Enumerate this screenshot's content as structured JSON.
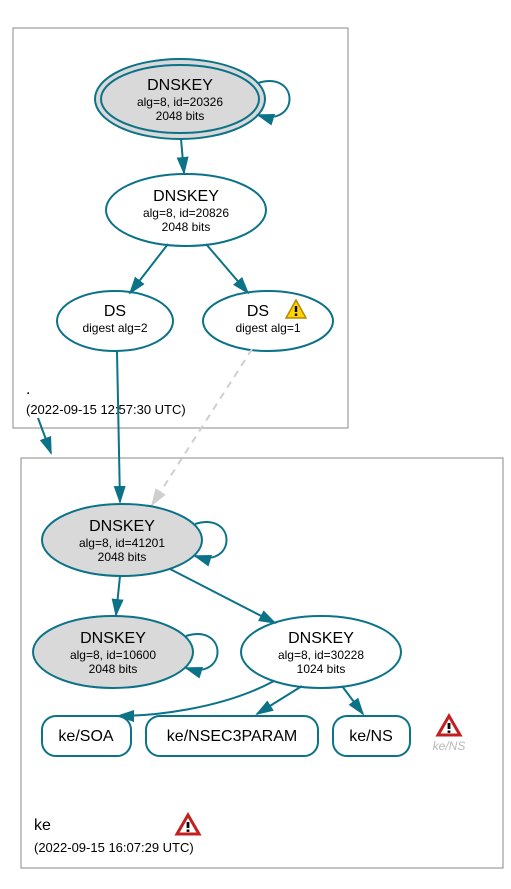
{
  "zones": {
    "root": {
      "label": ".",
      "timestamp": "(2022-09-15 12:57:30 UTC)"
    },
    "child": {
      "label": "ke",
      "timestamp": "(2022-09-15 16:07:29 UTC)"
    }
  },
  "nodes": {
    "ksk_root": {
      "title": "DNSKEY",
      "l1": "alg=8, id=20326",
      "l2": "2048 bits"
    },
    "zsk_root": {
      "title": "DNSKEY",
      "l1": "alg=8, id=20826",
      "l2": "2048 bits"
    },
    "ds2": {
      "title": "DS",
      "l1": "digest alg=2"
    },
    "ds1": {
      "title": "DS",
      "l1": "digest alg=1"
    },
    "ksk_ke": {
      "title": "DNSKEY",
      "l1": "alg=8, id=41201",
      "l2": "2048 bits"
    },
    "zsk_ke_a": {
      "title": "DNSKEY",
      "l1": "alg=8, id=10600",
      "l2": "2048 bits"
    },
    "zsk_ke_b": {
      "title": "DNSKEY",
      "l1": "alg=8, id=30228",
      "l2": "1024 bits"
    },
    "soa": {
      "label": "ke/SOA"
    },
    "nsec3": {
      "label": "ke/NSEC3PARAM"
    },
    "ns": {
      "label": "ke/NS"
    },
    "ns_warn": {
      "label": "ke/NS"
    }
  },
  "icons": {
    "warn_yellow": "warning-icon",
    "warn_red": "error-icon"
  }
}
